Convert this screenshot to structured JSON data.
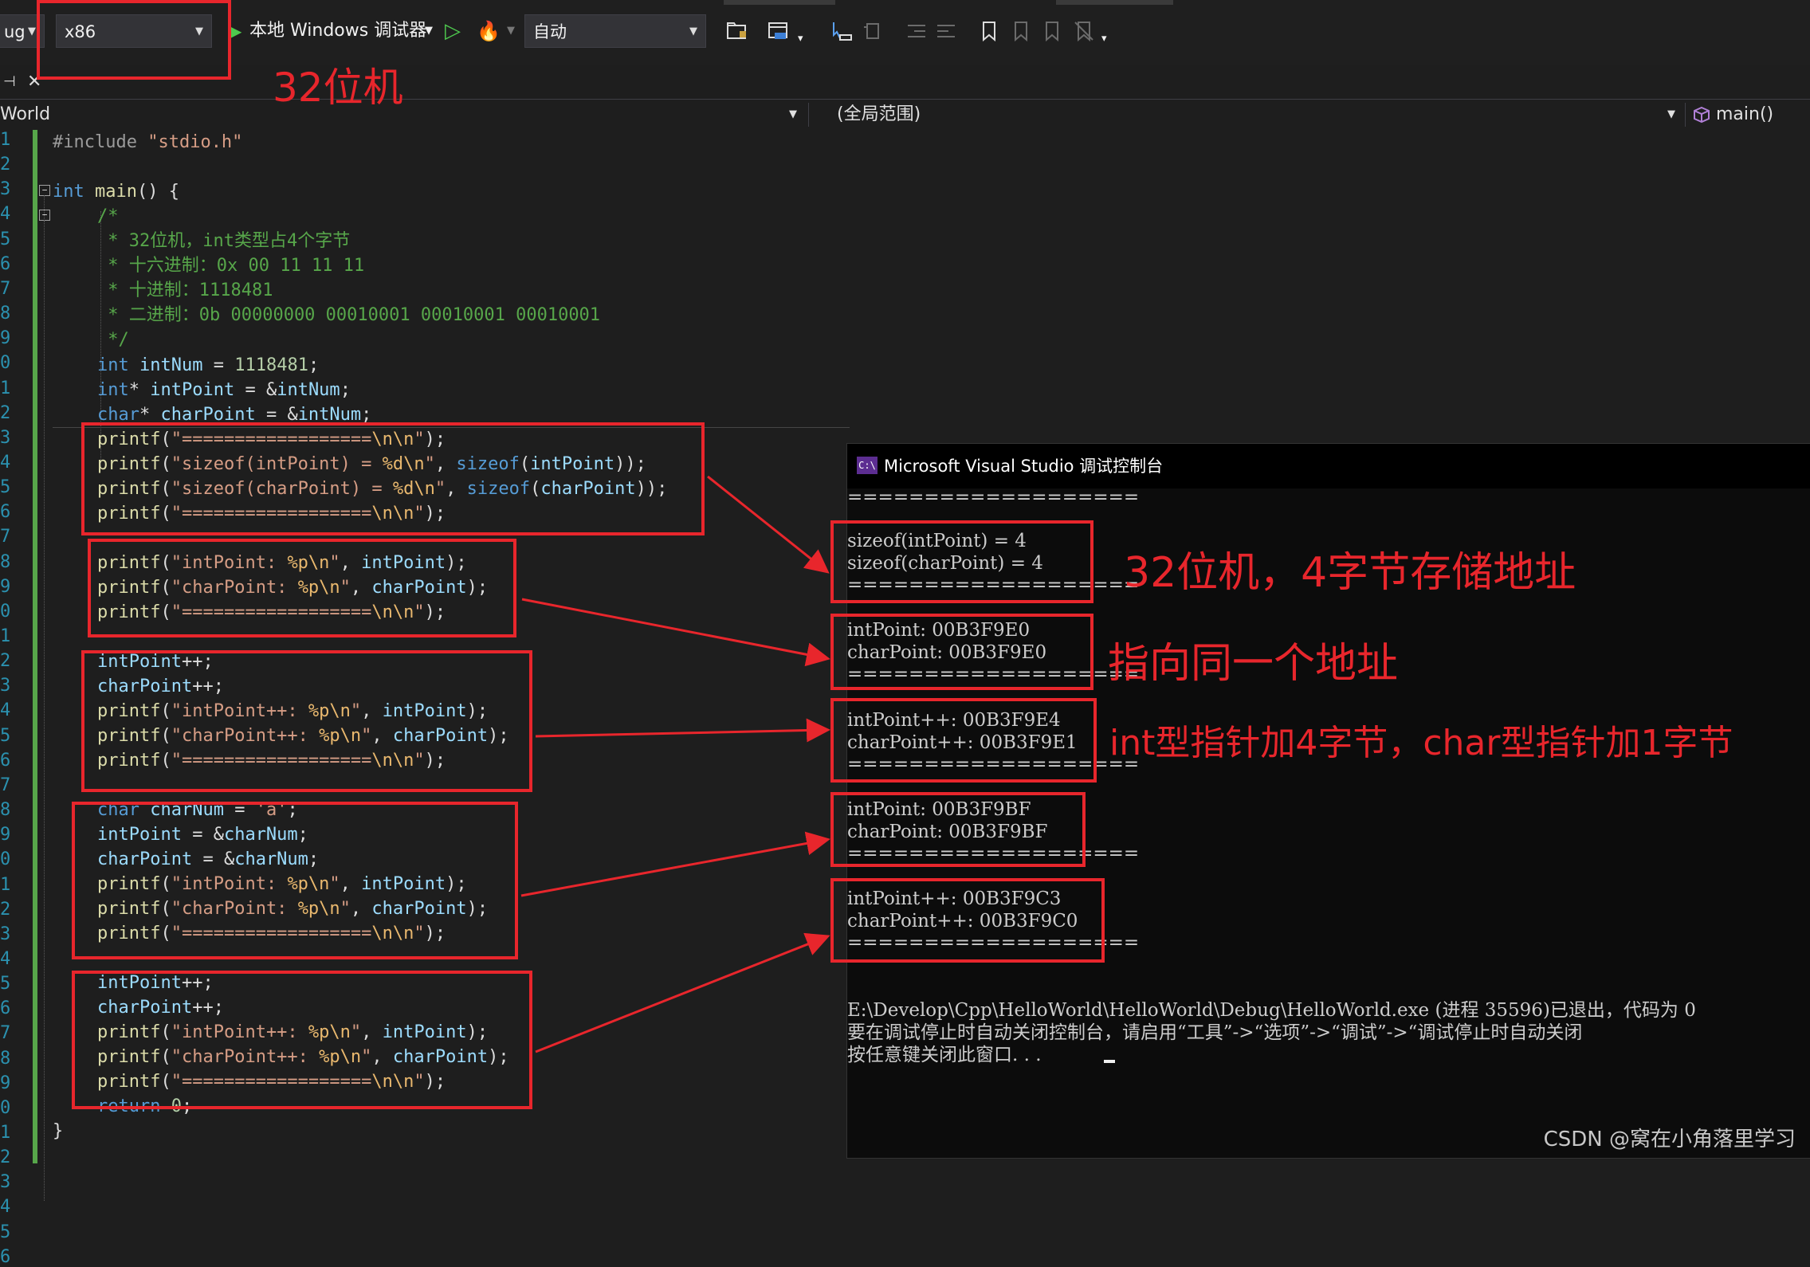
{
  "toolbar": {
    "config_partial": "ug",
    "platform": "x86",
    "debugger_label": "本地 Windows 调试器",
    "auto_label": "自动"
  },
  "navbar": {
    "project": "World",
    "scope": "(全局范围)",
    "function": "main()"
  },
  "editor": {
    "line_numbers": [
      "1",
      "2",
      "3",
      "4",
      "5",
      "6",
      "7",
      "8",
      "9",
      "0",
      "1",
      "2",
      "3",
      "4",
      "5",
      "6",
      "7",
      "8",
      "9",
      "0",
      "1",
      "2",
      "3",
      "4",
      "5",
      "6",
      "7",
      "8",
      "9",
      "0",
      "1",
      "2",
      "3",
      "4",
      "5",
      "6",
      "7",
      "8",
      "9",
      "0",
      "1",
      "2",
      "3",
      "4",
      "5",
      "6"
    ],
    "comment_lines": [
      "/*",
      " * 32位机，int类型占4个字节",
      " * 十六进制：0x 00 11 11 11",
      " * 十进制：1118481",
      " * 二进制：0b 00000000 00010001 00010001 00010001",
      " */"
    ]
  },
  "console": {
    "title": "Microsoft Visual Studio 调试控制台",
    "lines": [
      "===================",
      "sizeof(intPoint) = 4",
      "sizeof(charPoint) = 4",
      "===================",
      "intPoint: 00B3F9E0",
      "charPoint: 00B3F9E0",
      "===================",
      "intPoint++: 00B3F9E4",
      "charPoint++: 00B3F9E1",
      "===================",
      "intPoint: 00B3F9BF",
      "charPoint: 00B3F9BF",
      "===================",
      "intPoint++: 00B3F9C3",
      "charPoint++: 00B3F9C0",
      "===================",
      "E:\\Develop\\Cpp\\HelloWorld\\HelloWorld\\Debug\\HelloWorld.exe (进程 35596)已退出，代码为 0",
      "要在调试停止时自动关闭控制台，请启用“工具”->“选项”->“调试”->“调试停止时自动关闭",
      "按任意键关闭此窗口. . ."
    ]
  },
  "annotations": {
    "platform_note": "32位机",
    "note_sizeof": "32位机，4字节存储地址",
    "note_same_address": "指向同一个地址",
    "note_increment": "int型指针加4字节，char型指针加1字节"
  },
  "watermark": "CSDN @窝在小角落里学习",
  "colors": {
    "annotation_red": "#e8262c",
    "editor_bg": "#1e1e1e",
    "console_bg": "#0c0c0c",
    "comment_green": "#57a64a",
    "keyword_blue": "#569cd6"
  }
}
